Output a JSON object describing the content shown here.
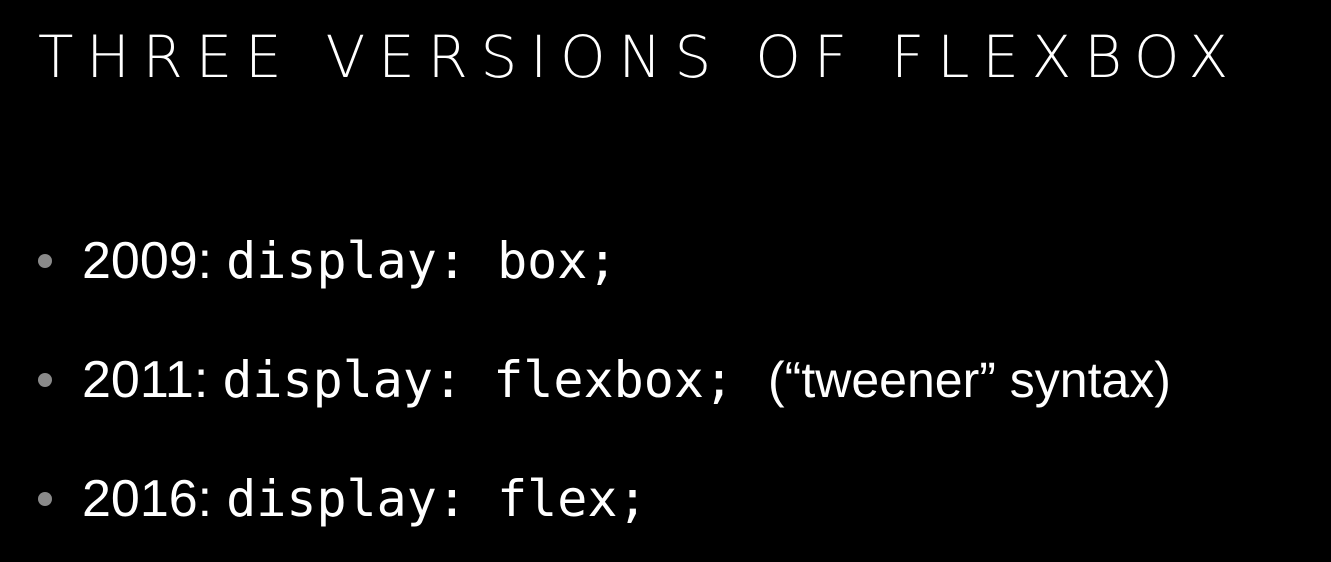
{
  "slide": {
    "title": "THREE VERSIONS OF FLEXBOX",
    "bullets": [
      {
        "year": "2009:",
        "code": "display: box;",
        "note": ""
      },
      {
        "year": "2011:",
        "code": "display: flexbox;",
        "note": "(“tweener” syntax)"
      },
      {
        "year": "2016:",
        "code": "display: flex;",
        "note": ""
      }
    ]
  },
  "colors": {
    "background": "#000000",
    "text": "#ffffff",
    "bullet_dot": "#8a8a8a"
  }
}
